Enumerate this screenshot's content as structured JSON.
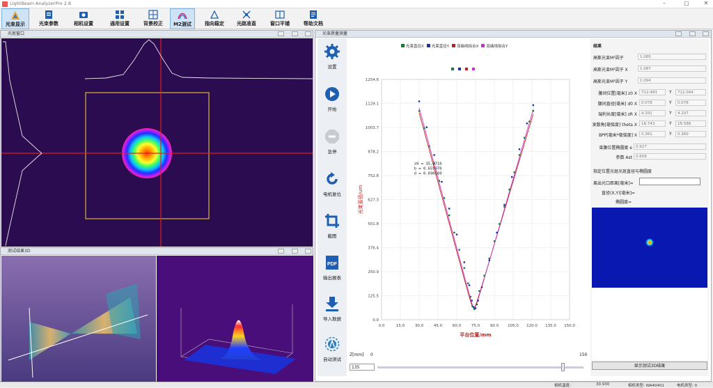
{
  "app": {
    "title": "LightBeam AnalyzerPro 2.8"
  },
  "toolbar": {
    "items": [
      {
        "label": "光束显示"
      },
      {
        "label": "光束参数"
      },
      {
        "label": "相机设置"
      },
      {
        "label": "通用设置"
      },
      {
        "label": "背景校正"
      },
      {
        "label": "M2测试"
      },
      {
        "label": "指向稳定"
      },
      {
        "label": "光路准直"
      },
      {
        "label": "窗口平铺"
      },
      {
        "label": "帮助文档"
      }
    ]
  },
  "spot_panel": {
    "title": "光斑窗口"
  },
  "m3d_panel": {
    "title": "测试结果3D"
  },
  "measure_panel": {
    "title": "光束质量测量"
  },
  "sidebar": {
    "items": [
      {
        "label": "设置"
      },
      {
        "label": "开始"
      },
      {
        "label": "急停"
      },
      {
        "label": "电机复位"
      },
      {
        "label": "截图"
      },
      {
        "label": "输出报表"
      },
      {
        "label": "导入数据"
      },
      {
        "label": "自动测试"
      }
    ],
    "pdf_text": "PDF"
  },
  "chart_data": {
    "type": "scatter",
    "legend": [
      "光束直径X",
      "光束直径Y",
      "双曲线拟合X",
      "双曲线拟合Y"
    ],
    "legend_colors": [
      "#1a7a3a",
      "#1f2fa8",
      "#c02020",
      "#cc30cc"
    ],
    "xlabel": "平台位置/mm",
    "ylabel": "光束直径/um",
    "xlim": [
      0,
      150
    ],
    "ylim": [
      0,
      1254.6
    ],
    "xticks": [
      "0.0",
      "15.0",
      "30.0",
      "45.0",
      "60.0",
      "75.0",
      "90.0",
      "105.0",
      "120.0",
      "135.0",
      "150.0"
    ],
    "yticks": [
      "0.0",
      "125.5",
      "250.9",
      "376.4",
      "501.8",
      "627.3",
      "752.8",
      "878.2",
      "1003.7",
      "1129.1",
      "1254.6"
    ],
    "fit_text": [
      "z0 = 35.7716",
      "b = 0.659970",
      "d = 0.690589"
    ],
    "series": [
      {
        "name": "光束直径X",
        "color": "#1a7a3a",
        "x": [
          30,
          34,
          38,
          42,
          46,
          50,
          54,
          58,
          62,
          66,
          69,
          71,
          72.5,
          74,
          76,
          78,
          82,
          86,
          90,
          94,
          98,
          102,
          106,
          110,
          114,
          118,
          121
        ],
        "y": [
          1090,
          1000,
          905,
          815,
          725,
          635,
          545,
          455,
          365,
          270,
          190,
          120,
          70,
          55,
          80,
          150,
          230,
          320,
          410,
          500,
          590,
          680,
          770,
          860,
          950,
          1035,
          1090
        ]
      },
      {
        "name": "光束直径Y",
        "color": "#1f2fa8",
        "x": [
          30,
          36,
          42,
          48,
          54,
          60,
          66,
          70,
          72,
          73.5,
          75,
          77,
          80,
          86,
          92,
          98,
          104,
          110,
          116,
          121
        ],
        "y": [
          1140,
          1005,
          860,
          720,
          580,
          445,
          300,
          180,
          100,
          65,
          60,
          100,
          170,
          310,
          455,
          600,
          745,
          890,
          1025,
          1120
        ]
      }
    ],
    "fits": [
      {
        "name": "双曲线拟合X",
        "color": "#c02020",
        "x": [
          30,
          73.5,
          121
        ],
        "y": [
          1110,
          58,
          1100
        ]
      },
      {
        "name": "双曲线拟合Y",
        "color": "#cc30cc",
        "x": [
          30,
          74,
          121
        ],
        "y": [
          1135,
          60,
          1125
        ]
      }
    ]
  },
  "zbar": {
    "label": "Z[mm]",
    "min": "0",
    "max": "150",
    "value": "135"
  },
  "results": {
    "header": "结果",
    "rows": [
      {
        "label": "高斯光束M²因子",
        "value": "1.085"
      },
      {
        "label": "高斯光束M²因子 X",
        "value": "1.087"
      },
      {
        "label": "高斯光束M²因子 Y",
        "value": "1.094"
      }
    ],
    "pair_rows": [
      {
        "label": "腰间位置[毫米] z0 X",
        "x": "712.483",
        "y_label": "Y",
        "y": "712.044"
      },
      {
        "label": "腰间直径[毫米] d0 X",
        "x": "0.078",
        "y_label": "Y",
        "y": "0.078"
      },
      {
        "label": "瑞利长度[毫米] zR X",
        "x": "4.201",
        "y_label": "Y",
        "y": "4.207"
      },
      {
        "label": "发散角[毫弧度] theta X",
        "x": "18.743",
        "y_label": "Y",
        "y": "18.588"
      },
      {
        "label": "BPP[毫米*毫弧度] X",
        "x": "0.361",
        "y_label": "Y",
        "y": "0.360"
      }
    ],
    "extra_rows": [
      {
        "label": "束腰位置椭圆度 e",
        "value": "0.927"
      },
      {
        "label": "参数 Ast",
        "value": "0.609"
      }
    ],
    "section2": "指定位置光斑光斑直径与椭圆度",
    "dist_label": "离出光口距离[毫米]=",
    "diam_label": "直径(X,Y)[毫米]=",
    "ellip_label": "椭圆度=",
    "button": "显示测试3D结果"
  },
  "status": {
    "temp_label": "相机温度:",
    "temp_value": "30.930",
    "camera_label": "相机类型: WA40401",
    "motor_label": "电机类型: 0"
  }
}
